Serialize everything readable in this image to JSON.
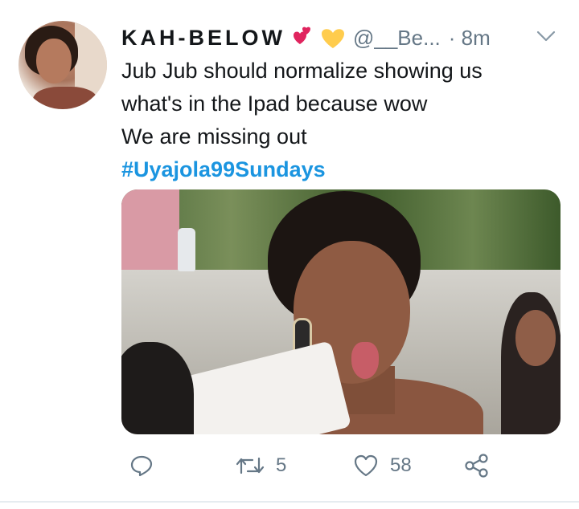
{
  "tweet": {
    "display_name": "KAH-BELOW",
    "handle": "@__Be...",
    "time": "· 8m",
    "lines": [
      "Jub Jub should normalize showing us",
      "what's in the Ipad because wow",
      "We are missing out"
    ],
    "hashtag": "#Uyajola99Sundays"
  },
  "actions": {
    "reply_count": "",
    "retweet_count": "5",
    "like_count": "58"
  },
  "icons": {
    "reply": "reply-icon",
    "retweet": "retweet-icon",
    "like": "heart-icon",
    "share": "share-icon",
    "caret": "chevron-down-icon",
    "emoji_1": "two-hearts-emoji",
    "emoji_2": "yellow-heart-emoji"
  },
  "colors": {
    "link": "#1b95e0",
    "secondary_text": "#657786",
    "primary_text": "#14171a",
    "heart_pink": "#e0245e",
    "heart_yellow": "#ffcc4d"
  }
}
